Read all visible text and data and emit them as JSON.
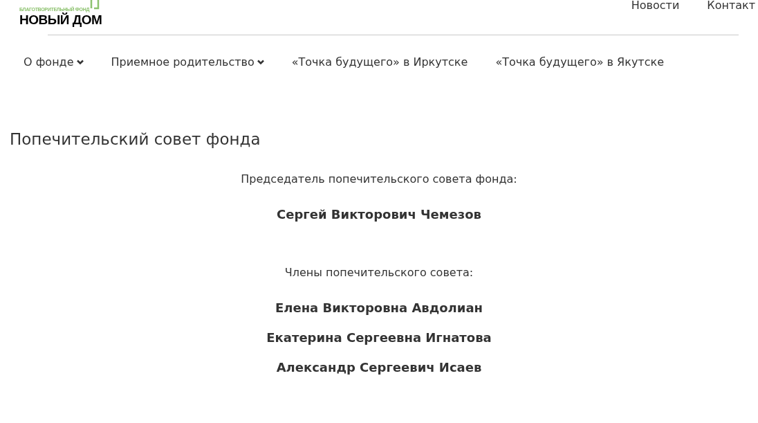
{
  "logo": {
    "tagline": "БЛАГОТВОРИТЕЛЬНЫЙ ФОНД",
    "name": "НОВЫЙ ДОМ"
  },
  "top_nav": [
    "Новости",
    "Контакт"
  ],
  "menu": [
    {
      "label": "О фонде",
      "dropdown": true
    },
    {
      "label": "Приемное родительство",
      "dropdown": true
    },
    {
      "label": "«Точка будущего» в Иркутске",
      "dropdown": false
    },
    {
      "label": "«Точка будущего» в Якутске",
      "dropdown": false
    }
  ],
  "heading": "Попечительский совет фонда",
  "sections": [
    {
      "caption": "Председатель попечительского совета фонда:",
      "names": [
        "Сергей Викторович Чемезов"
      ]
    },
    {
      "caption": "Члены попечительского совета:",
      "names": [
        "Елена Викторовна Авдолиан",
        "Екатерина Сергеевна Игнатова",
        "Александр Сергеевич Исаев"
      ]
    }
  ]
}
